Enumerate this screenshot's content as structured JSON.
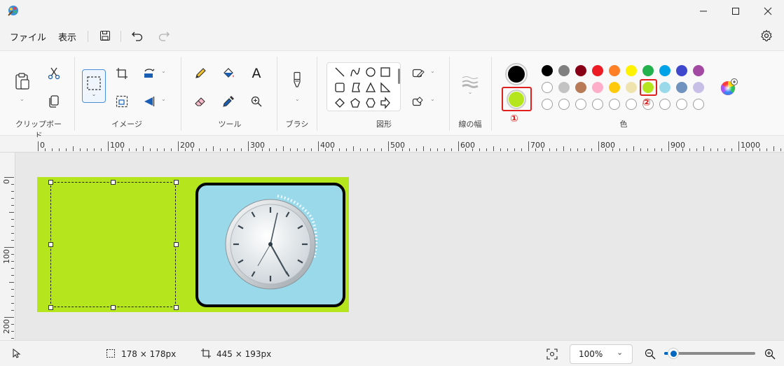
{
  "menu": {
    "file": "ファイル",
    "view": "表示"
  },
  "ribbon": {
    "clipboard": "クリップボード",
    "image": "イメージ",
    "tools": "ツール",
    "brush": "ブラシ",
    "shapes": "図形",
    "line_width": "線の幅",
    "colors": "色"
  },
  "colors": {
    "primary": "#000000",
    "secondary": "#b5e61d",
    "row1": [
      "#000000",
      "#7f7f7f",
      "#880015",
      "#ed1c24",
      "#ff7f27",
      "#fff200",
      "#22b14c",
      "#00a2e8",
      "#3f48cc",
      "#a349a4"
    ],
    "row2": [
      "#ffffff",
      "#c3c3c3",
      "#b97a57",
      "#ffaec9",
      "#ffc90e",
      "#efe4b0",
      "#b5e61d",
      "#99d9ea",
      "#7092be",
      "#c8bfe7"
    ],
    "row3_empty_count": 10
  },
  "annotations": {
    "one": "①",
    "two": "②"
  },
  "ruler": {
    "top": [
      "0",
      "100",
      "200",
      "300",
      "400",
      "500",
      "600",
      "700",
      "800",
      "900",
      "1000"
    ],
    "left": [
      "0",
      "100",
      "200"
    ]
  },
  "status": {
    "selection_size": "178 × 178px",
    "canvas_size": "445 × 193px",
    "zoom": "100%",
    "zoom_level": 0.1
  }
}
